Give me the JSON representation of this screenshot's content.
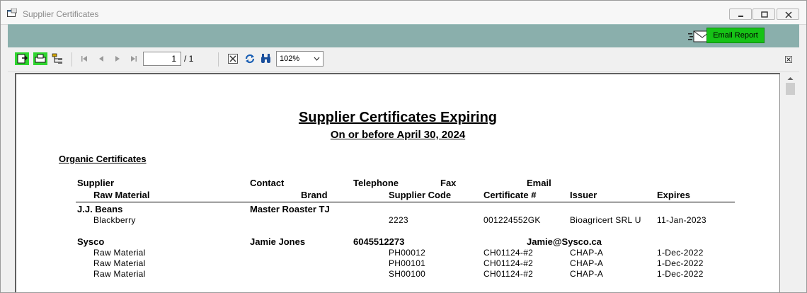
{
  "window": {
    "title": "Supplier Certificates"
  },
  "actions": {
    "email_report_label": "Email Report"
  },
  "toolbar": {
    "page_current": "1",
    "page_total": "/ 1",
    "zoom": "102%"
  },
  "report": {
    "title": "Supplier Certificates Expiring",
    "subtitle": "On or before April 30, 2024",
    "section": "Organic Certificates",
    "headers_row1": {
      "supplier": "Supplier",
      "contact": "Contact",
      "telephone": "Telephone",
      "fax": "Fax",
      "email": "Email"
    },
    "headers_row2": {
      "raw_material": "Raw Material",
      "brand": "Brand",
      "supplier_code": "Supplier Code",
      "certificate": "Certificate #",
      "issuer": "Issuer",
      "expires": "Expires"
    },
    "groups": [
      {
        "supplier": "J.J. Beans",
        "contact": "Master Roaster TJ",
        "telephone": "",
        "email": "",
        "rows": [
          {
            "material": "Blackberry",
            "code": "2223",
            "certificate": "001224552GK",
            "issuer": "Bioagricert SRL U",
            "expires": "11-Jan-2023"
          }
        ]
      },
      {
        "supplier": "Sysco",
        "contact": "Jamie Jones",
        "telephone": "6045512273",
        "email": "Jamie@Sysco.ca",
        "rows": [
          {
            "material": "Raw Material",
            "code": "PH00012",
            "certificate": "CH01124-#2",
            "issuer": "CHAP-A",
            "expires": "1-Dec-2022"
          },
          {
            "material": "Raw Material",
            "code": "PH00101",
            "certificate": "CH01124-#2",
            "issuer": "CHAP-A",
            "expires": "1-Dec-2022"
          },
          {
            "material": "Raw Material",
            "code": "SH00100",
            "certificate": "CH01124-#2",
            "issuer": "CHAP-A",
            "expires": "1-Dec-2022"
          }
        ]
      }
    ]
  }
}
